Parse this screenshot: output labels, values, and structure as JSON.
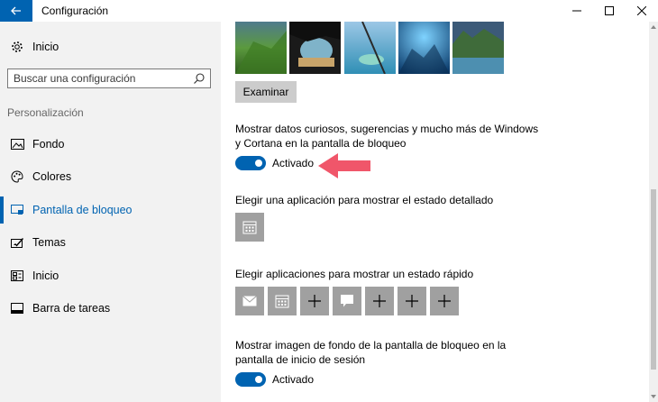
{
  "window": {
    "title": "Configuración",
    "back_icon": "arrow-left-icon",
    "minimize_icon": "minimize-icon",
    "maximize_icon": "maximize-icon",
    "close_icon": "close-icon"
  },
  "sidebar": {
    "home_label": "Inicio",
    "search_placeholder": "Buscar una configuración",
    "section": "Personalización",
    "items": [
      {
        "label": "Fondo",
        "icon": "image-icon"
      },
      {
        "label": "Colores",
        "icon": "palette-icon"
      },
      {
        "label": "Pantalla de bloqueo",
        "icon": "lock-screen-icon",
        "active": true
      },
      {
        "label": "Temas",
        "icon": "theme-brush-icon"
      },
      {
        "label": "Inicio",
        "icon": "start-tiles-icon"
      },
      {
        "label": "Barra de tareas",
        "icon": "taskbar-icon"
      }
    ]
  },
  "main": {
    "browse_button": "Examinar",
    "fun_facts": {
      "label": "Mostrar datos curiosos, sugerencias y mucho más de Windows y Cortana en la pantalla de bloqueo",
      "toggle_state": "Activado"
    },
    "detailed_status": {
      "label": "Elegir una aplicación para mostrar el estado detallado",
      "tile_icon": "calendar-icon"
    },
    "quick_status": {
      "label": "Elegir aplicaciones para mostrar un estado rápido",
      "tiles": [
        "mail-icon",
        "calendar-icon",
        "plus-icon",
        "chat-icon",
        "plus-icon",
        "plus-icon",
        "plus-icon"
      ]
    },
    "signin_background": {
      "label": "Mostrar imagen de fondo de la pantalla de bloqueo en la pantalla de inicio de sesión",
      "toggle_state": "Activado"
    }
  },
  "colors": {
    "accent": "#0063b1",
    "annotation_arrow": "#f0566a",
    "tile_bg": "#a0a0a0",
    "sidebar_bg": "#f2f2f2"
  }
}
